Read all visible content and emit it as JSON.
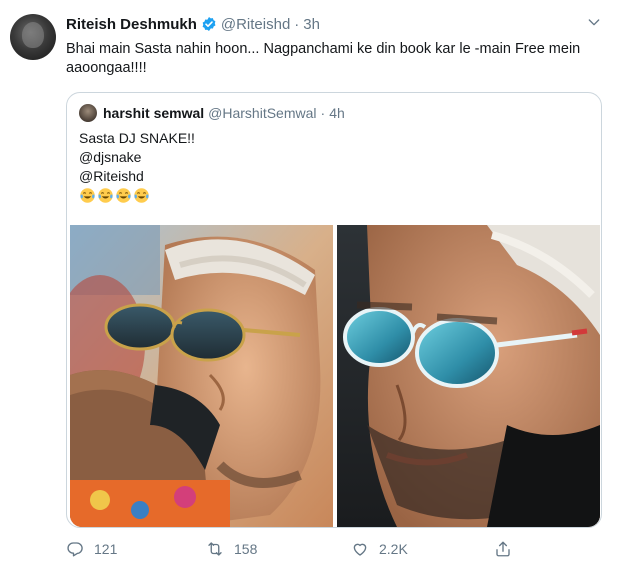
{
  "tweet": {
    "author_name": "Riteish Deshmukh",
    "author_handle": "@Riteishd",
    "separator": "·",
    "time": "3h",
    "text": "Bhai main Sasta nahin hoon... Nagpanchami ke din book kar le -main Free mein aaoongaa!!!!"
  },
  "quote": {
    "author_name": "harshit semwal",
    "author_handle": "@HarshitSemwal",
    "separator": "·",
    "time": "4h",
    "lines": [
      "Sasta DJ SNAKE!!",
      "@djsnake",
      "@Riteishd"
    ],
    "emoji": [
      "face-with-tears-of-joy",
      "face-with-tears-of-joy",
      "face-with-tears-of-joy",
      "face-with-tears-of-joy"
    ]
  },
  "actions": {
    "reply_count": "121",
    "retweet_count": "158",
    "like_count": "2.2K"
  },
  "colors": {
    "text": "#14171a",
    "secondary": "#657786",
    "verified": "#1da1f2",
    "border": "#ccd6dd"
  },
  "icons": [
    "verified-badge-icon",
    "chevron-down-icon",
    "reply-icon",
    "retweet-icon",
    "like-icon",
    "share-icon"
  ]
}
